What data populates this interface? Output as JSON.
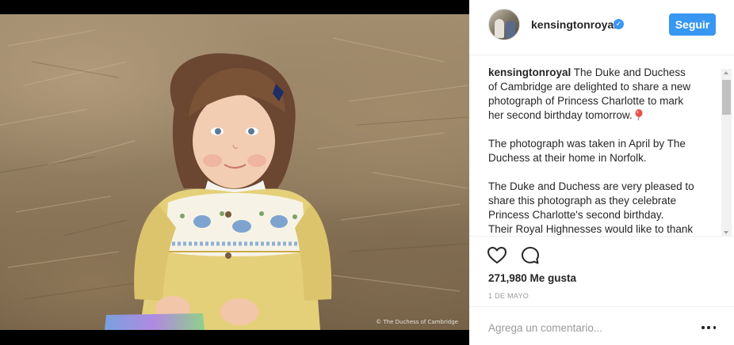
{
  "post": {
    "username": "kensingtonroyal",
    "follow_label": "Seguir",
    "verified_symbol": "✓",
    "photo_credit": "© The Duchess of Cambridge",
    "caption": {
      "user": "kensingtonroyal",
      "paragraph1": "The Duke and Duchess of Cambridge are delighted to share a new photograph of Princess Charlotte to mark her second birthday tomorrow.",
      "balloon_icon": "balloon-emoji",
      "paragraph2": "The photograph was taken in April by The Duchess at their home in Norfolk.",
      "paragraph3": "The Duke and Duchess are very pleased to share this photograph as they celebrate Princess Charlotte's second birthday.",
      "paragraph4": "Their Royal Highnesses would like to thank"
    },
    "likes_label": "271,980 Me gusta",
    "date_label": "1 DE MAYO",
    "comment_placeholder": "Agrega un comentario..."
  },
  "icons": {
    "like": "heart-icon",
    "comment": "speech-bubble-icon",
    "more": "ellipsis-icon"
  },
  "colors": {
    "accent": "#3897f0",
    "text": "#262626",
    "muted": "#999999",
    "divider": "#efefef"
  }
}
